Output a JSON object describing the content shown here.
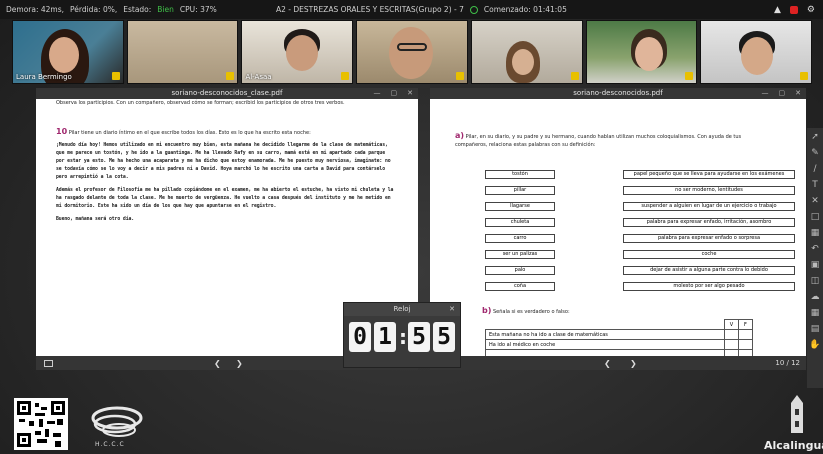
{
  "status_bar": {
    "latency": "Demora: 42ms,",
    "loss": "Pérdida: 0%,",
    "state": "Estado:",
    "state_value": "Bien",
    "cpu": "CPU: 37%",
    "meeting_title": "A2 - DESTREZAS ORALES Y ESCRITAS(Grupo 2) - 7",
    "started": "Comenzado: 01:41:05"
  },
  "participants": [
    {
      "name": "Laura Bermingo"
    },
    {
      "name": ""
    },
    {
      "name": "Al-Asaa"
    },
    {
      "name": ""
    },
    {
      "name": ""
    },
    {
      "name": ""
    },
    {
      "name": ""
    }
  ],
  "left_doc": {
    "title": "soriano-desconocidos_clase.pdf",
    "intro": "Observa los participios. Con un compañero, observad cómo se forman; escribid los participios de otros tres verbos.",
    "exercise_num": "10",
    "exercise_text": "Pilar tiene un diario íntimo en el que escribe todos los días. Esto es lo que ha escrito esta noche:",
    "diary_1": "¡Menudo día hoy! Hemos utilizado en mi encuentro muy bien, esta mañana he decidido llegarme de la clase de matemáticas, que me parece un tostón, y he ido a la guantinga. Me ha llevado Rafy en su carro, mamá está en mi apartado cada parque por estar ya esto. Me ha hecho una acaparata y me ha dicho que estoy enamorada. Me he puesto muy nerviosa, imaginate: no se todavía cómo se lo voy a decir a mis padres ni a David. Hoya marchó lo he escrito una carta a David para contárselo pero arrepintió a la cota.",
    "diary_2": "Además el profesor de Filosofía me ha pillado copiándome en el examen, me ha abierto el estuche, ha visto mi chuleta y la ha rasgado delante de toda la clase. Me he muerto de vergüenza. He vuelto a casa después del instituto y me he metido en mi dormitorio. Este ha sido un día de los que hay que apuntarse en el registro.",
    "diary_3": "Bueno, mañana será otro día."
  },
  "right_doc": {
    "title": "soriano-desconocidos.pdf",
    "ex_a_label": "a)",
    "ex_a_text": "Pilar, en su diario, y su padre y su hermano, cuando hablan utilizan muchos coloquialismos. Con ayuda de tus compañeros, relaciona estas palabras con su definición:",
    "words": [
      "tostón",
      "pillar",
      "llagarse",
      "chuleta",
      "carro",
      "ser un palizas",
      "palo",
      "coña"
    ],
    "definitions": [
      "papel pequeño que se lleva para ayudarse en los exámenes",
      "no ser moderno, lentitudes",
      "suspender a alguien en lugar de un ejercicio o trabajo",
      "palabra para expresar enfado, irritación, asombro",
      "palabra para expresar enfado o sorpresa",
      "coche",
      "dejar de asistir a alguna parte contra lo debido",
      "molesto por ser algo pesado"
    ],
    "ex_b_label": "b)",
    "ex_b_text": "Señala si es verdadero o falso:",
    "vf_headers": [
      "V",
      "F"
    ],
    "statements": [
      "Esta mañana no ha ido a clase de matemáticas",
      "Ha ido al médico en coche",
      ""
    ],
    "page_indicator": "10 / 12"
  },
  "timer": {
    "title": "Reloj",
    "d1": "0",
    "d2": "1",
    "d3": "5",
    "d4": "5"
  },
  "bottom": {
    "logo_left_text": "H.C.C.C",
    "logo_right_text": "Alcalingua"
  },
  "colors": {
    "accent_pink": "#a0286e",
    "status_green": "#3fbf48",
    "record_red": "#dd2222"
  }
}
